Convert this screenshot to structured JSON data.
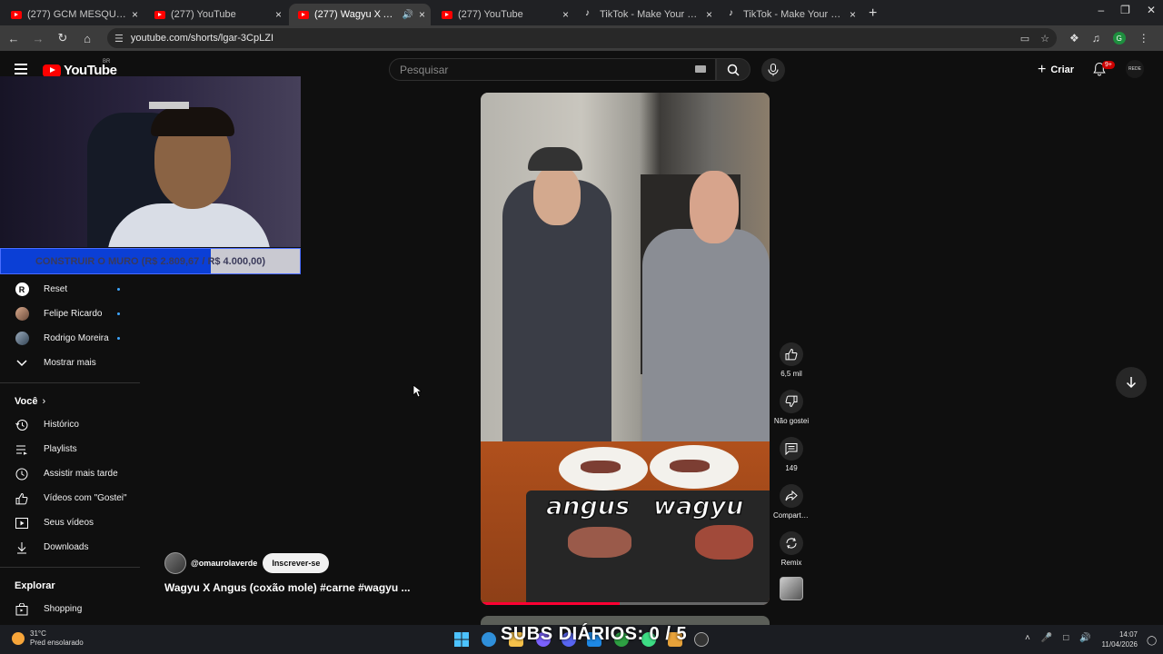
{
  "browser": {
    "tabs": [
      {
        "title": "(277) GCM MESQUITA - YouTube",
        "icon": "youtube-favicon",
        "active": false,
        "audio": false
      },
      {
        "title": "(277) YouTube",
        "icon": "youtube-favicon",
        "active": false,
        "audio": false
      },
      {
        "title": "(277) Wagyu X Angus (coxão mole)",
        "icon": "youtube-favicon",
        "active": true,
        "audio": true
      },
      {
        "title": "(277) YouTube",
        "icon": "youtube-favicon",
        "active": false,
        "audio": false
      },
      {
        "title": "TikTok - Make Your Day",
        "icon": "tiktok-favicon",
        "active": false,
        "audio": false
      },
      {
        "title": "TikTok - Make Your Day",
        "icon": "tiktok-favicon",
        "active": false,
        "audio": false
      }
    ],
    "url": "youtube.com/shorts/lgar-3CpLZI",
    "profile_initial": "G"
  },
  "youtube": {
    "logo_text": "YouTube",
    "country_code": "BR",
    "search_placeholder": "Pesquisar",
    "create_label": "Criar",
    "notif_badge": "9+",
    "avatar_text": "REDE"
  },
  "overlay": {
    "goal_text": "CONSTRUIR O MURO (R$ 2.809,67 / R$ 4.000,00)",
    "goal_current": 2809.67,
    "goal_target": 4000.0,
    "subs_text": "SUBS DIÁRIOS: 0 / 5"
  },
  "sidebar": {
    "subscriptions": [
      {
        "label": "Reset",
        "icon": "reset-channel-avatar"
      },
      {
        "label": "Felipe Ricardo",
        "icon": "channel-avatar"
      },
      {
        "label": "Rodrigo Moreira",
        "icon": "channel-avatar"
      }
    ],
    "show_more": "Mostrar mais",
    "you_heading": "Você",
    "you_items": [
      {
        "label": "Histórico",
        "icon": "history-icon"
      },
      {
        "label": "Playlists",
        "icon": "playlists-icon"
      },
      {
        "label": "Assistir mais tarde",
        "icon": "watch-later-icon"
      },
      {
        "label": "Vídeos com \"Gostei\"",
        "icon": "like-icon"
      },
      {
        "label": "Seus vídeos",
        "icon": "your-videos-icon"
      },
      {
        "label": "Downloads",
        "icon": "download-icon"
      }
    ],
    "explore_heading": "Explorar",
    "explore_items": [
      {
        "label": "Shopping",
        "icon": "shopping-bag-icon"
      }
    ]
  },
  "short": {
    "channel": "@omaurolaverde",
    "subscribe_label": "Inscrever-se",
    "title": "Wagyu X Angus (coxão mole) #carne #wagyu ...",
    "overlay_left": "angus",
    "overlay_right": "wagyu",
    "progress": 0.48,
    "actions": {
      "likes": "6,5 mil",
      "dislike_label": "Não gostei",
      "comments": "149",
      "share_label": "Compartil...",
      "remix_label": "Remix"
    }
  },
  "taskbar": {
    "temperature": "31°C",
    "weather": "Pred ensolarado",
    "time": "14:07",
    "date": "11/04/2026"
  }
}
